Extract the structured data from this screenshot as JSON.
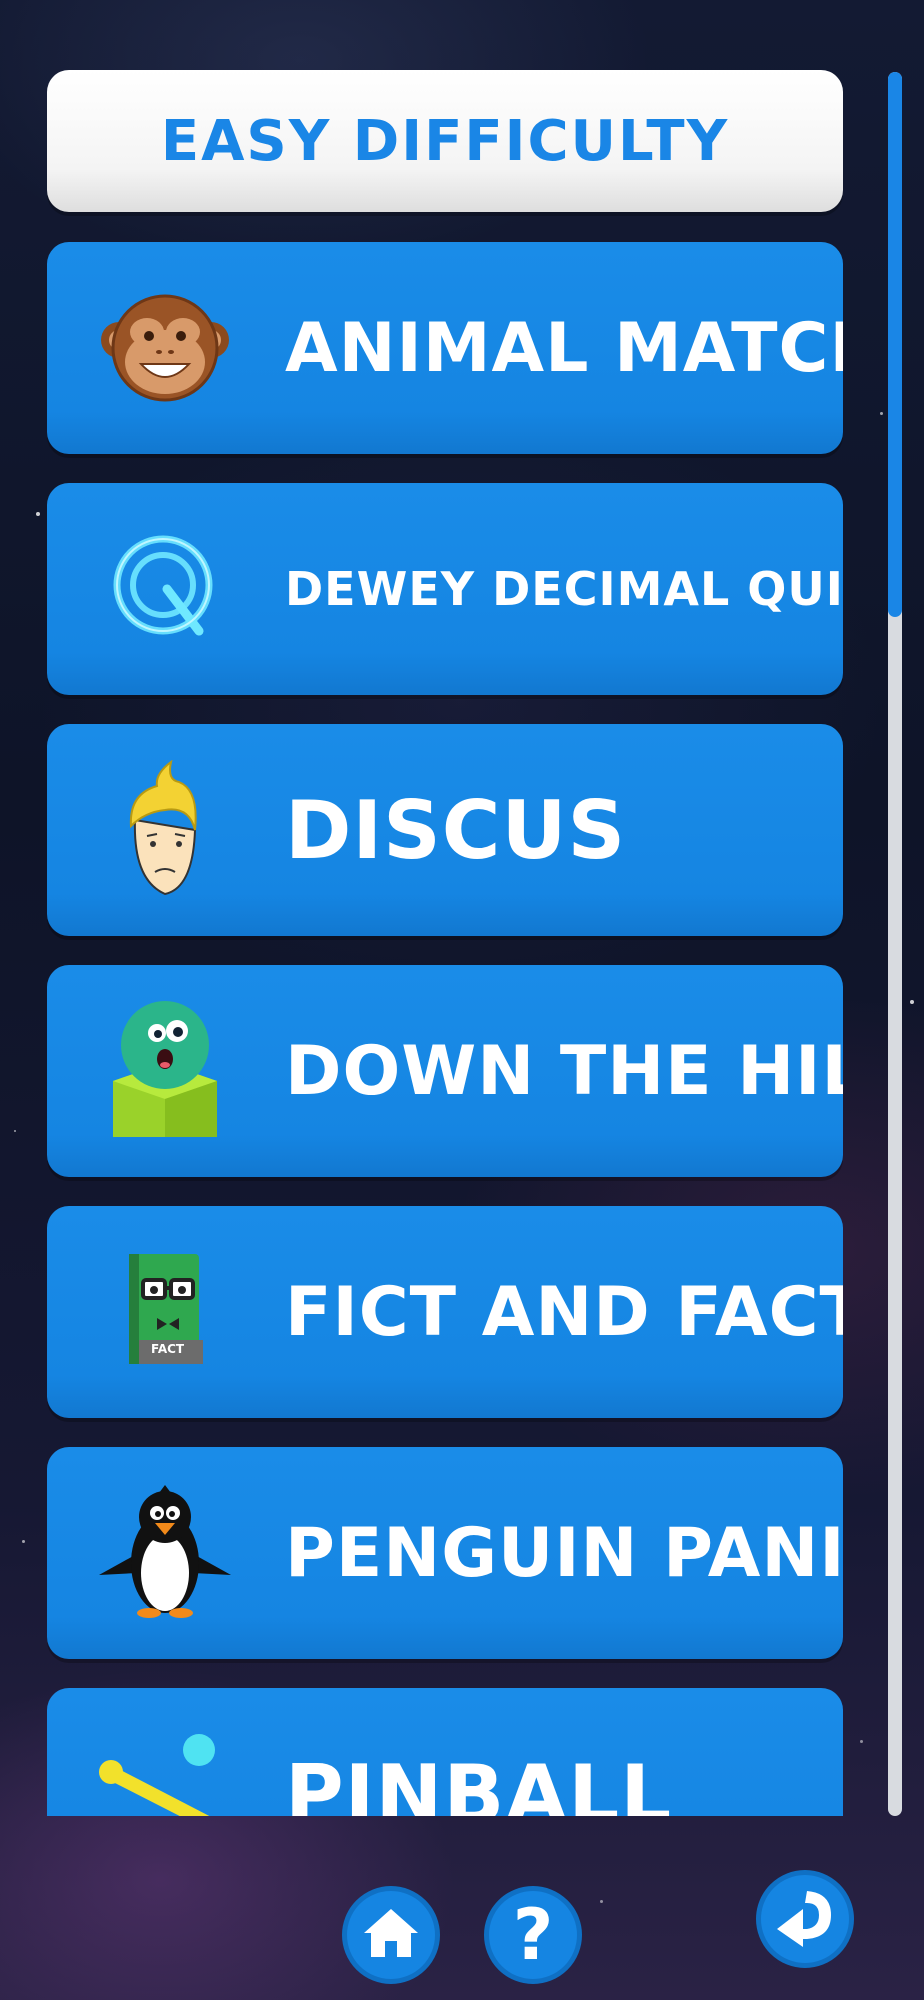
{
  "header": {
    "title": "EASY DIFFICULTY"
  },
  "games": [
    {
      "label": "ANIMAL MATCH",
      "icon": "monkey-icon"
    },
    {
      "label": "DEWEY DECIMAL QUIZ",
      "icon": "quiz-q-icon"
    },
    {
      "label": "DISCUS",
      "icon": "blonde-boy-icon"
    },
    {
      "label": "DOWN THE HILL",
      "icon": "green-ball-block-icon"
    },
    {
      "label": "FICT AND FACT",
      "icon": "fact-book-icon",
      "icon_text": "FACT"
    },
    {
      "label": "PENGUIN PANIC",
      "icon": "penguin-icon"
    },
    {
      "label": "PINBALL",
      "icon": "pinball-flipper-icon"
    }
  ],
  "footer": {
    "home": "home-icon",
    "help_label": "?",
    "back": "back-arrow-icon"
  },
  "colors": {
    "card_blue": "#1585e2",
    "header_text": "#1a86e6",
    "scroll_thumb": "#1a86e6"
  }
}
